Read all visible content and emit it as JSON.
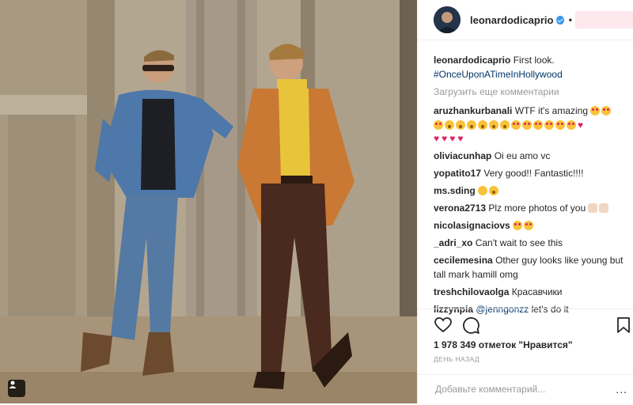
{
  "post": {
    "author": "leonardodicaprio",
    "separator": "•",
    "caption_user": "leonardodicaprio",
    "caption_text": "First look.",
    "caption_hashtag": "#OnceUponATimeInHollywood",
    "load_more": "Загрузить еще комментарии",
    "likes": "1 978 349 отметок \"Нравится\"",
    "time": "ДЕНЬ НАЗАД",
    "comment_placeholder": "Добавьте комментарий...",
    "more": "..."
  },
  "comments": [
    {
      "user": "aruzhankurbanali",
      "text": "WTF it's amazing"
    },
    {
      "user": "oliviacunhap",
      "text": "Oi eu amo vc"
    },
    {
      "user": "yopatito17",
      "text": "Very good!! Fantastic!!!!"
    },
    {
      "user": "ms.sding",
      "text": ""
    },
    {
      "user": "verona2713",
      "text": "Plz more photos of you"
    },
    {
      "user": "nicolasignaciovs",
      "text": ""
    },
    {
      "user": "_adri_xo",
      "text": "Can't wait to see this"
    },
    {
      "user": "cecilemesina",
      "text": "Other guy looks like young but tall mark hamill omg"
    },
    {
      "user": "treshchilovaolga",
      "text": "Красавчики"
    },
    {
      "user": "lizzynpia",
      "mention": "@jenngonzz",
      "text": "let's do it"
    }
  ],
  "icons": {
    "like": "heart-outline-icon",
    "comment": "speech-bubble-icon",
    "save": "bookmark-icon",
    "tag": "person-tag-icon"
  },
  "colors": {
    "verified": "#3897f0",
    "hashtag": "#003569",
    "muted": "#999999"
  }
}
